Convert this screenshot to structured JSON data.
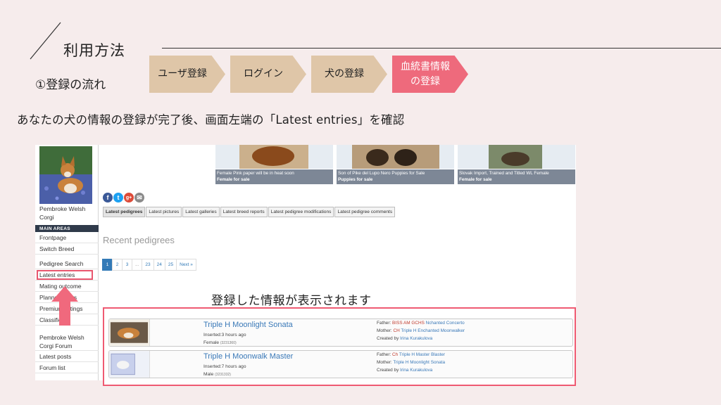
{
  "slide": {
    "title": "利用方法",
    "subtitle": "①登録の流れ",
    "instruction": "あなたの犬の情報の登録が完了後、画面左端の「Latest entries」を確認",
    "note": "登録した情報が表示されます"
  },
  "steps": [
    {
      "label": "ユーザ登録",
      "state": "done"
    },
    {
      "label": "ログイン",
      "state": "done"
    },
    {
      "label": "犬の登録",
      "state": "done"
    },
    {
      "label": "血統書情報\nの登録",
      "state": "current"
    }
  ],
  "colors": {
    "step_done": "#dfc6a8",
    "step_current": "#ee6a7c",
    "highlight": "#ef5a72",
    "link": "#3a79b8"
  },
  "sidebar": {
    "breed_line1": "Pembroke Welsh",
    "breed_line2": "Corgi",
    "section_heading": "MAIN AREAS",
    "items": [
      "Frontpage",
      "Switch Breed",
      "Pedigree Search",
      "Latest entries",
      "Mating outcome",
      "Planned litters",
      "Premium listings",
      "Classifieds",
      "Pembroke Welsh Corgi Forum",
      "Latest posts",
      "Forum list"
    ]
  },
  "thumbnails": [
    {
      "caption": "Female Pink paper will be in heat soon",
      "status": "Female for sale"
    },
    {
      "caption": "Son of Pike del Lupo Nero Puppies for Sale",
      "status": "Puppies for sale"
    },
    {
      "caption": "Slovak Import, Trained and Titled WL Female",
      "status": "Female for sale"
    }
  ],
  "social_icons": [
    {
      "name": "facebook-icon",
      "glyph": "f",
      "color": "#3b5998"
    },
    {
      "name": "twitter-icon",
      "glyph": "t",
      "color": "#1da1f2"
    },
    {
      "name": "googleplus-icon",
      "glyph": "g+",
      "color": "#dd4b39"
    },
    {
      "name": "email-icon",
      "glyph": "✉",
      "color": "#8a8a8a"
    }
  ],
  "tabs": [
    "Latest pedigrees",
    "Latest pictures",
    "Latest galleries",
    "Latest breed reports",
    "Latest pedigree modifications",
    "Latest pedigree comments"
  ],
  "recent_heading": "Recent pedigrees",
  "pagination": [
    "1",
    "2",
    "3",
    "...",
    "23",
    "24",
    "25",
    "Next »"
  ],
  "entries": [
    {
      "name": "Triple H Moonlight Sonata",
      "inserted": "Inserted:3 hours ago",
      "sex": "Female",
      "id": "(3231360)",
      "father_label": "Father:",
      "father_title": "BISS AM GCHS",
      "father_name": "Nchanted Concerto",
      "mother_label": "Mother:",
      "mother_title": "CH",
      "mother_name": "Triple H Enchanted Moonwalker",
      "created_label": "Created by",
      "created_by": "Irina Kurakulova"
    },
    {
      "name": "Triple H Moonwalk Master",
      "inserted": "Inserted:7 hours ago",
      "sex": "Male",
      "id": "(3231332)",
      "father_label": "Father:",
      "father_title": "Ch",
      "father_name": "Triple H Master Blaster",
      "mother_label": "Mother:",
      "mother_title": "",
      "mother_name": "Triple H Moonlight Sonata",
      "created_label": "Created by",
      "created_by": "Irina Kurakulova"
    }
  ]
}
